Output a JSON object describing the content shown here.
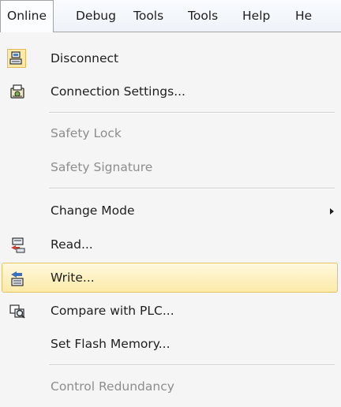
{
  "menubar": {
    "items": [
      {
        "label": "Online"
      },
      {
        "label": "Debug"
      },
      {
        "label": "Tools"
      },
      {
        "label": "Tools"
      },
      {
        "label": "Help"
      },
      {
        "label": "He"
      }
    ]
  },
  "online_menu": {
    "items": [
      {
        "label": "Disconnect",
        "icon": "disconnect-icon",
        "enabled": true
      },
      {
        "label": "Connection Settings...",
        "icon": "connection-settings-icon",
        "enabled": true
      },
      {
        "label": "Safety Lock",
        "enabled": false
      },
      {
        "label": "Safety Signature",
        "enabled": false
      },
      {
        "label": "Change Mode",
        "submenu": true,
        "enabled": true
      },
      {
        "label": "Read...",
        "icon": "read-from-plc-icon",
        "enabled": true
      },
      {
        "label": "Write...",
        "icon": "write-to-plc-icon",
        "enabled": true,
        "highlighted": true
      },
      {
        "label": "Compare with PLC...",
        "icon": "compare-with-plc-icon",
        "enabled": true
      },
      {
        "label": "Set Flash Memory...",
        "enabled": true
      },
      {
        "label": "Control Redundancy",
        "enabled": false
      }
    ]
  },
  "colors": {
    "highlight": "#fbeaa8",
    "highlight_border": "#e5c365",
    "menu_background": "#f5f5f5",
    "disabled_text": "#8d8d8d"
  }
}
